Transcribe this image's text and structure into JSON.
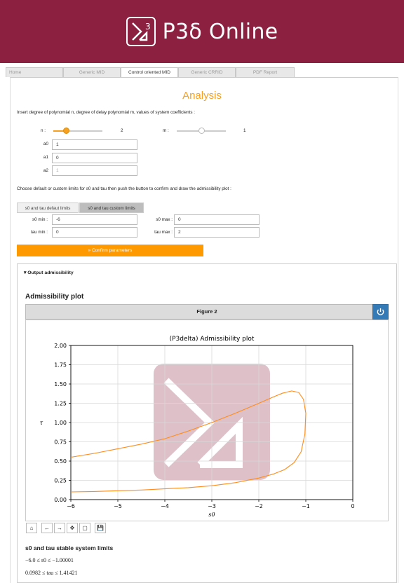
{
  "header": {
    "title": "P3δ Online",
    "logo_digit": "3"
  },
  "tabs": [
    "Home",
    "Generic MID",
    "Control oriented MID",
    "Generic CRRID",
    "PDF Report"
  ],
  "analysis": {
    "title": "Analysis",
    "instruction": "Insert degree of polynomial n, degree of delay polynomial m, values of system coefficients :",
    "n_label": "n :",
    "n_value": "2",
    "n_level": 0.25,
    "m_label": "m :",
    "m_value": "1",
    "m_level": 0.5,
    "coefficients": [
      {
        "label": "a0",
        "value": "1"
      },
      {
        "label": "a1",
        "value": "0"
      },
      {
        "label": "a2",
        "value": "1"
      }
    ],
    "limits_instruction": "Choose default or custom limits for s0 and tau then push the button to confirm and draw the admissibility plot :",
    "toggle_default": "s0 and tau defaut limits",
    "toggle_custom": "s0 and tau custom limits",
    "s0_min_label": "s0 min :",
    "s0_min": "-6",
    "s0_max_label": "s0 max :",
    "s0_max": "0",
    "tau_min_label": "tau min :",
    "tau_min": "0",
    "tau_max_label": "tau max :",
    "tau_max": "2",
    "confirm_label": "» Confirm parameters"
  },
  "output": {
    "section_label": "▾ Output admissibility",
    "plot_heading": "Admissibility plot",
    "figure_title": "Figure 2",
    "limits_heading": "s0 and tau stable system limits",
    "s0_limits": "−6.0 ≤ s0 ≤ −1.00001",
    "tau_limits": "0.0982 ≤ tau ≤ 1.41421"
  },
  "toolbar_icons": [
    "home-icon",
    "back-icon",
    "forward-icon",
    "pan-icon",
    "zoom-icon",
    "save-icon"
  ],
  "colors": {
    "banner": "#8c2040",
    "accent": "#f7a020",
    "button": "#ff9900",
    "power": "#337ab7"
  },
  "chart_data": {
    "type": "line",
    "title": "(P3delta) Admissibility plot",
    "xlabel": "s0",
    "ylabel": "τ",
    "xlim": [
      -6,
      0
    ],
    "ylim": [
      0,
      2
    ],
    "xticks": [
      "−6",
      "−5",
      "−4",
      "−3",
      "−2",
      "−1",
      "0"
    ],
    "yticks": [
      "0.00",
      "0.25",
      "0.50",
      "0.75",
      "1.00",
      "1.25",
      "1.50",
      "1.75",
      "2.00"
    ],
    "grid": true,
    "series": [
      {
        "x": [
          -6.0,
          -5.5,
          -5.0,
          -4.5,
          -4.0,
          -3.5,
          -3.0,
          -2.5,
          -2.0,
          -1.7,
          -1.5,
          -1.3,
          -1.15,
          -1.05,
          -1.0,
          -1.02,
          -1.1,
          -1.25,
          -1.45,
          -1.7,
          -2.0,
          -2.5,
          -3.0,
          -3.5,
          -4.0,
          -4.5,
          -5.0,
          -5.5,
          -6.0
        ],
        "y": [
          0.55,
          0.6,
          0.66,
          0.72,
          0.79,
          0.89,
          1.0,
          1.12,
          1.25,
          1.33,
          1.38,
          1.41,
          1.39,
          1.3,
          1.12,
          0.85,
          0.62,
          0.48,
          0.39,
          0.33,
          0.28,
          0.22,
          0.18,
          0.155,
          0.14,
          0.125,
          0.115,
          0.105,
          0.1
        ]
      }
    ]
  }
}
